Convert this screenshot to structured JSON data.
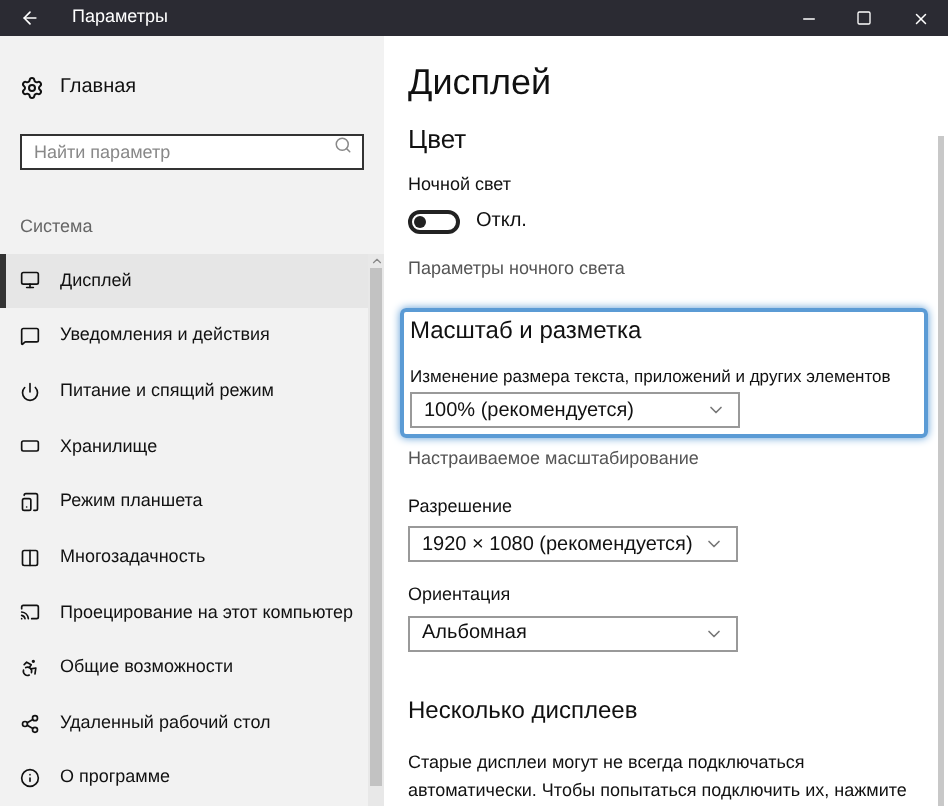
{
  "window": {
    "title": "Параметры"
  },
  "sidebar": {
    "home": "Главная",
    "search": {
      "placeholder": "Найти параметр"
    },
    "section": "Система",
    "items": [
      {
        "label": "Дисплей",
        "selected": true
      },
      {
        "label": "Уведомления и действия",
        "selected": false
      },
      {
        "label": "Питание и спящий режим",
        "selected": false
      },
      {
        "label": "Хранилище",
        "selected": false
      },
      {
        "label": "Режим планшета",
        "selected": false
      },
      {
        "label": "Многозадачность",
        "selected": false
      },
      {
        "label": "Проецирование на этот компьютер",
        "selected": false
      },
      {
        "label": "Общие возможности",
        "selected": false
      },
      {
        "label": "Удаленный рабочий стол",
        "selected": false
      },
      {
        "label": "О программе",
        "selected": false
      }
    ]
  },
  "content": {
    "title": "Дисплей",
    "color_heading": "Цвет",
    "night_light": {
      "label": "Ночной свет",
      "on": false,
      "state": "Откл."
    },
    "night_link": "Параметры ночного света",
    "scale": {
      "heading": "Масштаб и разметка",
      "label": "Изменение размера текста, приложений и других элементов",
      "value": "100% (рекомендуется)",
      "custom_link": "Настраиваемое масштабирование"
    },
    "resolution": {
      "label": "Разрешение",
      "value": "1920 × 1080 (рекомендуется)"
    },
    "orientation": {
      "label": "Ориентация",
      "value": "Альбомная"
    },
    "multi": {
      "heading": "Несколько дисплеев",
      "text": "Старые дисплеи могут не всегда подключаться автоматически. Чтобы попытаться подключить их, нажмите"
    }
  }
}
